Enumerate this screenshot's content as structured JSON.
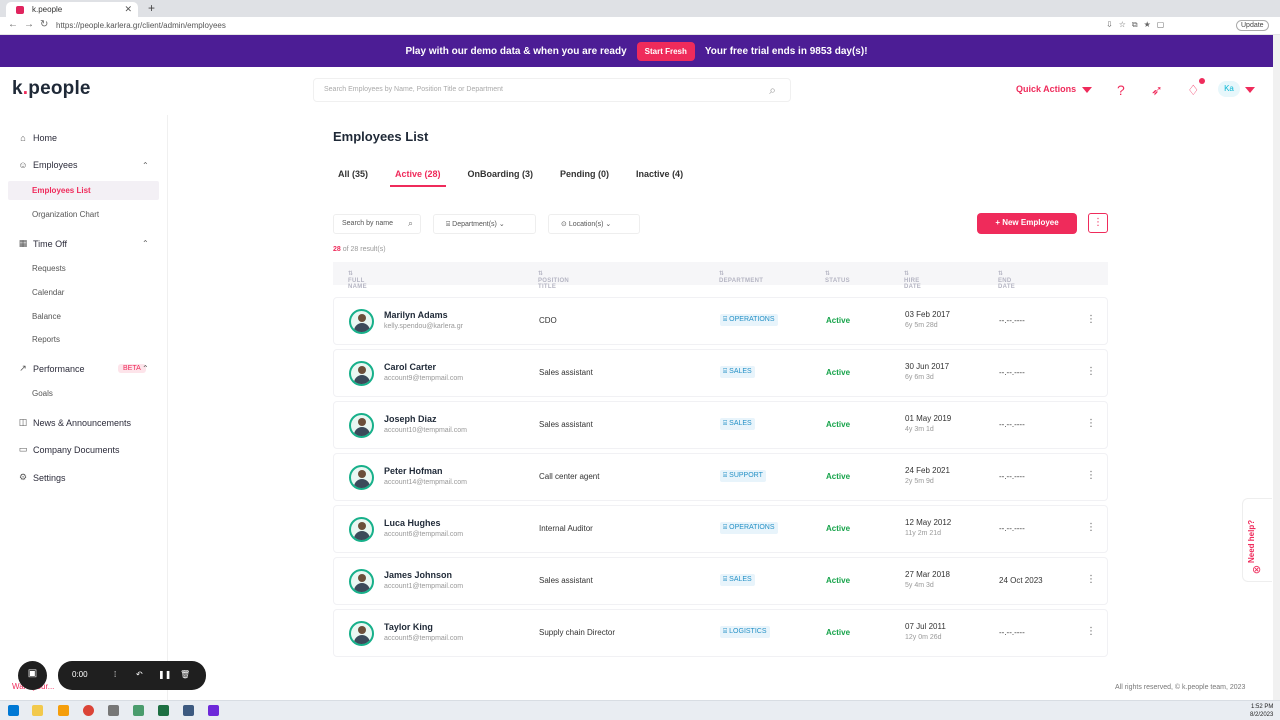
{
  "browser": {
    "tab_title": "k.people",
    "url": "https://people.karlera.gr/client/admin/employees",
    "profile_label": "Update"
  },
  "banner": {
    "text": "Play with our demo data & when you are ready",
    "button": "Start Fresh",
    "trial": "Your free trial ends in 9853 day(s)!"
  },
  "header": {
    "logo": "k.people",
    "search_placeholder": "Search Employees by Name, Position Title or Department",
    "quick_actions": "Quick Actions",
    "avatar_initials": "Ka"
  },
  "sidebar": {
    "home": "Home",
    "employees": "Employees",
    "employees_list": "Employees List",
    "org_chart": "Organization Chart",
    "time_off": "Time Off",
    "requests": "Requests",
    "calendar": "Calendar",
    "balance": "Balance",
    "reports": "Reports",
    "performance": "Performance",
    "beta": "BETA",
    "goals": "Goals",
    "news": "News & Announcements",
    "documents": "Company Documents",
    "settings": "Settings"
  },
  "main": {
    "title": "Employees List",
    "tabs": [
      "All (35)",
      "Active (28)",
      "OnBoarding (3)",
      "Pending (0)",
      "Inactive (4)"
    ],
    "search_by_name": "Search by name",
    "department_filter": "Department(s)",
    "location_filter": "Location(s)",
    "new_employee": "+ New Employee",
    "results_count": "28",
    "results_rest": " of 28 result(s)",
    "columns": [
      "FULL NAME",
      "POSITION TITLE",
      "DEPARTMENT",
      "STATUS",
      "HIRE DATE",
      "END DATE"
    ]
  },
  "employees": [
    {
      "name": "Marilyn Adams",
      "email": "kelly.spendou@karlera.gr",
      "position": "CDO",
      "department": "OPERATIONS",
      "status": "Active",
      "hire_date": "03 Feb 2017",
      "tenure": "6y 5m 28d",
      "end_date": "--.--.----"
    },
    {
      "name": "Carol Carter",
      "email": "account9@tempmail.com",
      "position": "Sales assistant",
      "department": "SALES",
      "status": "Active",
      "hire_date": "30 Jun 2017",
      "tenure": "6y 6m 3d",
      "end_date": "--.--.----"
    },
    {
      "name": "Joseph Diaz",
      "email": "account10@tempmail.com",
      "position": "Sales assistant",
      "department": "SALES",
      "status": "Active",
      "hire_date": "01 May 2019",
      "tenure": "4y 3m 1d",
      "end_date": "--.--.----"
    },
    {
      "name": "Peter Hofman",
      "email": "account14@tempmail.com",
      "position": "Call center agent",
      "department": "SUPPORT",
      "status": "Active",
      "hire_date": "24 Feb 2021",
      "tenure": "2y 5m 9d",
      "end_date": "--.--.----"
    },
    {
      "name": "Luca Hughes",
      "email": "account6@tempmail.com",
      "position": "Internal Auditor",
      "department": "OPERATIONS",
      "status": "Active",
      "hire_date": "12 May 2012",
      "tenure": "11y 2m 21d",
      "end_date": "--.--.----"
    },
    {
      "name": "James Johnson",
      "email": "account1@tempmail.com",
      "position": "Sales assistant",
      "department": "SALES",
      "status": "Active",
      "hire_date": "27 Mar 2018",
      "tenure": "5y 4m 3d",
      "end_date": "24 Oct 2023"
    },
    {
      "name": "Taylor King",
      "email": "account5@tempmail.com",
      "position": "Supply chain Director",
      "department": "LOGISTICS",
      "status": "Active",
      "hire_date": "07 Jul 2011",
      "tenure": "12y 0m 26d",
      "end_date": "--.--.----"
    }
  ],
  "footer": "All rights reserved, © k.people team, 2023",
  "need_help": "Need help?",
  "recorder": {
    "time": "0:00",
    "want": "Want your..."
  },
  "clock": {
    "time": "1:52 PM",
    "date": "8/2/2023"
  },
  "colors": {
    "brand": "#ef2b5b",
    "banner": "#4c1d95",
    "active_status": "#16a34a",
    "department": "#2591c6"
  }
}
